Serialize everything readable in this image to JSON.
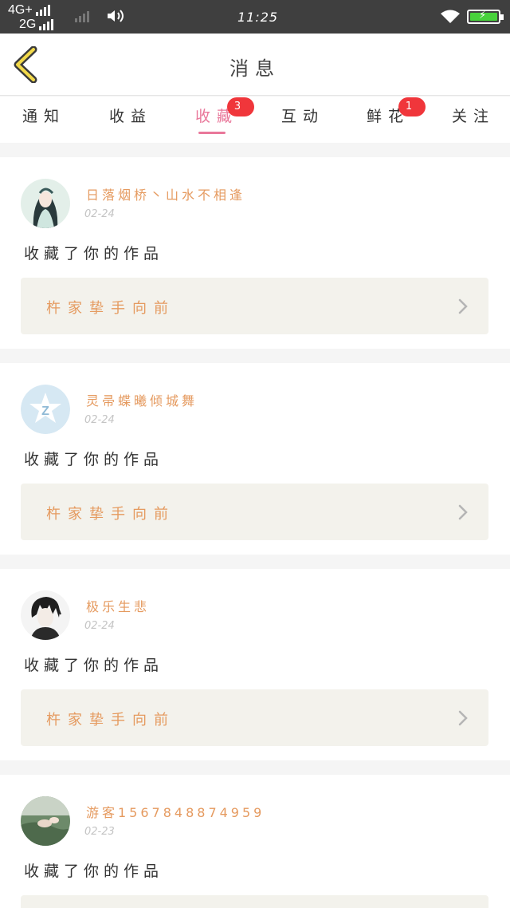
{
  "status_bar": {
    "network_top": "4G+",
    "network_bottom": "2G",
    "time": "11:25"
  },
  "header": {
    "title": "消息"
  },
  "tabs": [
    {
      "label": "通知",
      "badge": ""
    },
    {
      "label": "收益",
      "badge": ""
    },
    {
      "label": "收藏",
      "badge": "3",
      "active": true
    },
    {
      "label": "互动",
      "badge": ""
    },
    {
      "label": "鲜花",
      "badge": "1"
    },
    {
      "label": "关注",
      "badge": ""
    }
  ],
  "colors": {
    "accent": "#e9779a",
    "badge": "#f0363b",
    "orange_text": "#e59a5f"
  },
  "messages": [
    {
      "username": "日落烟桥丶山水不相逢",
      "date": "02-24",
      "action": "收藏了你的作品",
      "work_title": "杵家挚手向前",
      "avatar": "illustrated-woman"
    },
    {
      "username": "灵帚蝶曦倾城舞",
      "date": "02-24",
      "action": "收藏了你的作品",
      "work_title": "杵家挚手向前",
      "avatar": "default-z-logo"
    },
    {
      "username": "极乐生悲",
      "date": "02-24",
      "action": "收藏了你的作品",
      "work_title": "杵家挚手向前",
      "avatar": "illustrated-man"
    },
    {
      "username": "游客1567848874959",
      "date": "02-23",
      "action": "收藏了你的作品",
      "work_title": "",
      "avatar": "photo"
    }
  ]
}
